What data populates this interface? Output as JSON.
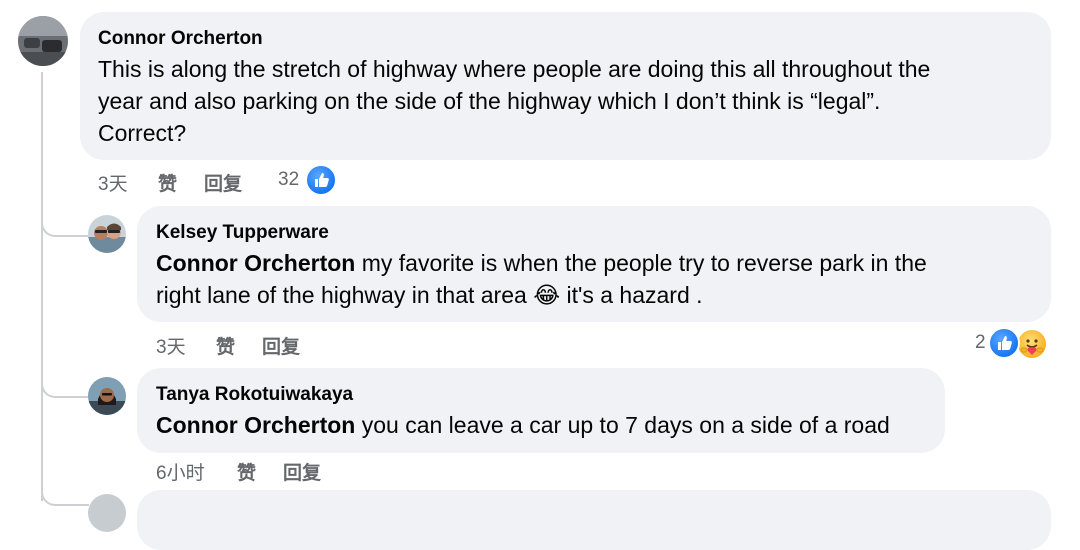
{
  "comments": [
    {
      "author": "Connor Orcherton",
      "lines": [
        "This is along the stretch of highway where people are doing this all throughout the",
        "year and also parking on the side of the highway which I don’t think is “legal”.",
        "Correct?"
      ],
      "time": "3天",
      "like_label": "赞",
      "reply_label": "回复",
      "reaction_count": "32"
    },
    {
      "author": "Kelsey Tupperware",
      "mention": "Connor Orcherton",
      "line1_rest": "my favorite is when the people try to reverse park in the",
      "line2_a": "right lane of the highway in that area",
      "emoji": "😂",
      "line2_b": "it's a hazard .",
      "time": "3天",
      "like_label": "赞",
      "reply_label": "回复",
      "reaction_count": "2"
    },
    {
      "author": "Tanya Rokotuiwakaya",
      "mention": "Connor Orcherton",
      "rest": "you can leave a car up to 7 days on a side of a road",
      "time": "6小时",
      "like_label": "赞",
      "reply_label": "回复"
    }
  ],
  "icons": {
    "like": "like-reaction-icon",
    "care": "care-reaction-icon"
  },
  "colors": {
    "bubble": "#f0f2f5",
    "meta_text": "#65676b",
    "like_blue": "#1877f2",
    "thread_line": "#ced0d4"
  }
}
